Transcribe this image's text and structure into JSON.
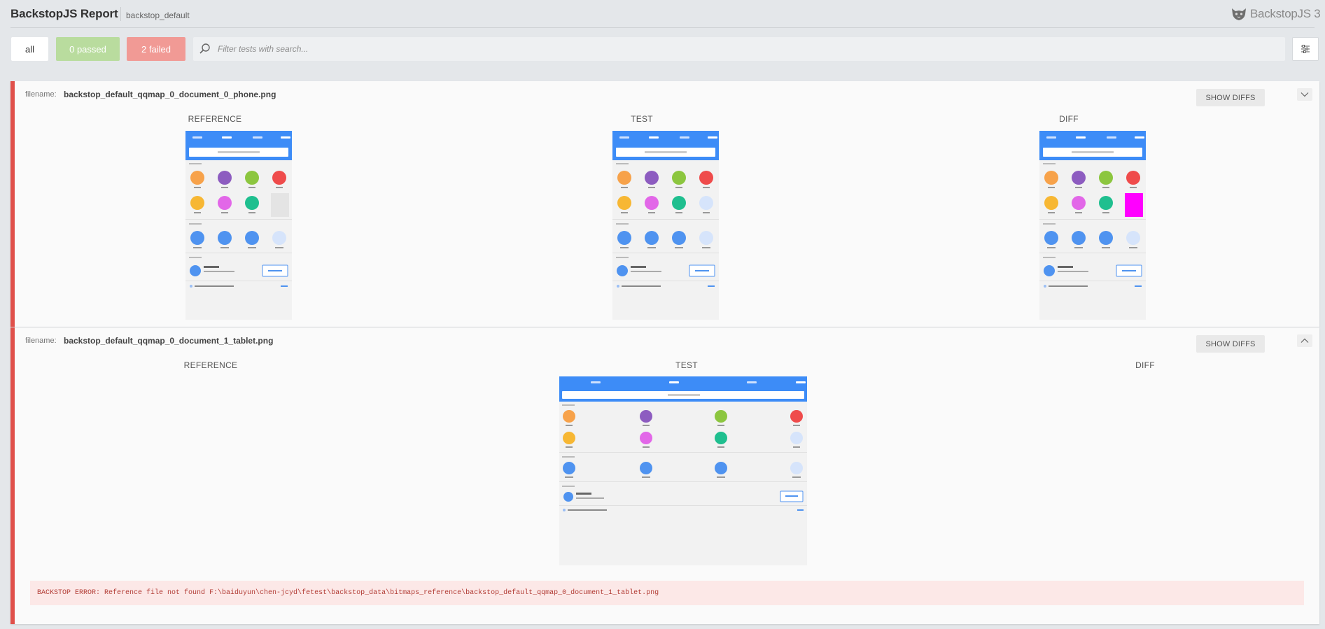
{
  "header": {
    "title": "BackstopJS Report",
    "subtitle": "backstop_default",
    "brand": "BackstopJS 3"
  },
  "toolbar": {
    "all_label": "all",
    "passed_label": "0 passed",
    "failed_label": "2 failed",
    "search_placeholder": "Filter tests with search...",
    "icons": [
      "search-icon",
      "sliders-icon"
    ]
  },
  "colors": {
    "passed": "#b9dc9e",
    "failed": "#f19a95",
    "fail_border": "#e0504a",
    "phone_blue": "#3d8cf7",
    "diff_magenta": "#ff00ff"
  },
  "tests": [
    {
      "filename_label": "filename:",
      "filename": "backstop_default_qqmap_0_document_0_phone.png",
      "show_diffs_label": "SHOW DIFFS",
      "toggle_icon": "chevron-down-icon",
      "columns": [
        "REFERENCE",
        "TEST",
        "DIFF"
      ]
    },
    {
      "filename_label": "filename:",
      "filename": "backstop_default_qqmap_0_document_1_tablet.png",
      "show_diffs_label": "SHOW DIFFS",
      "toggle_icon": "chevron-up-icon",
      "columns": [
        "REFERENCE",
        "TEST",
        "DIFF"
      ],
      "error": "BACKSTOP ERROR: Reference file not found F:\\baiduyun\\chen-jcyd\\fetest\\backstop_data\\bitmaps_reference\\backstop_default_qqmap_0_document_1_tablet.png"
    }
  ]
}
